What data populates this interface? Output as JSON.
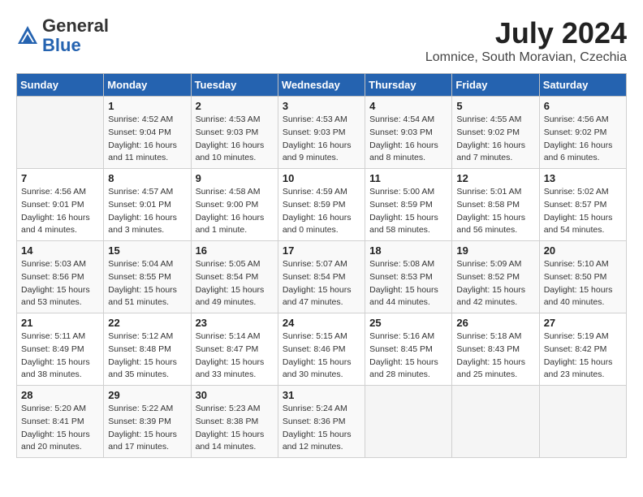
{
  "header": {
    "logo_general": "General",
    "logo_blue": "Blue",
    "month_title": "July 2024",
    "subtitle": "Lomnice, South Moravian, Czechia"
  },
  "days_of_week": [
    "Sunday",
    "Monday",
    "Tuesday",
    "Wednesday",
    "Thursday",
    "Friday",
    "Saturday"
  ],
  "weeks": [
    [
      {
        "day": "",
        "info": ""
      },
      {
        "day": "1",
        "info": "Sunrise: 4:52 AM\nSunset: 9:04 PM\nDaylight: 16 hours\nand 11 minutes."
      },
      {
        "day": "2",
        "info": "Sunrise: 4:53 AM\nSunset: 9:03 PM\nDaylight: 16 hours\nand 10 minutes."
      },
      {
        "day": "3",
        "info": "Sunrise: 4:53 AM\nSunset: 9:03 PM\nDaylight: 16 hours\nand 9 minutes."
      },
      {
        "day": "4",
        "info": "Sunrise: 4:54 AM\nSunset: 9:03 PM\nDaylight: 16 hours\nand 8 minutes."
      },
      {
        "day": "5",
        "info": "Sunrise: 4:55 AM\nSunset: 9:02 PM\nDaylight: 16 hours\nand 7 minutes."
      },
      {
        "day": "6",
        "info": "Sunrise: 4:56 AM\nSunset: 9:02 PM\nDaylight: 16 hours\nand 6 minutes."
      }
    ],
    [
      {
        "day": "7",
        "info": "Sunrise: 4:56 AM\nSunset: 9:01 PM\nDaylight: 16 hours\nand 4 minutes."
      },
      {
        "day": "8",
        "info": "Sunrise: 4:57 AM\nSunset: 9:01 PM\nDaylight: 16 hours\nand 3 minutes."
      },
      {
        "day": "9",
        "info": "Sunrise: 4:58 AM\nSunset: 9:00 PM\nDaylight: 16 hours\nand 1 minute."
      },
      {
        "day": "10",
        "info": "Sunrise: 4:59 AM\nSunset: 8:59 PM\nDaylight: 16 hours\nand 0 minutes."
      },
      {
        "day": "11",
        "info": "Sunrise: 5:00 AM\nSunset: 8:59 PM\nDaylight: 15 hours\nand 58 minutes."
      },
      {
        "day": "12",
        "info": "Sunrise: 5:01 AM\nSunset: 8:58 PM\nDaylight: 15 hours\nand 56 minutes."
      },
      {
        "day": "13",
        "info": "Sunrise: 5:02 AM\nSunset: 8:57 PM\nDaylight: 15 hours\nand 54 minutes."
      }
    ],
    [
      {
        "day": "14",
        "info": "Sunrise: 5:03 AM\nSunset: 8:56 PM\nDaylight: 15 hours\nand 53 minutes."
      },
      {
        "day": "15",
        "info": "Sunrise: 5:04 AM\nSunset: 8:55 PM\nDaylight: 15 hours\nand 51 minutes."
      },
      {
        "day": "16",
        "info": "Sunrise: 5:05 AM\nSunset: 8:54 PM\nDaylight: 15 hours\nand 49 minutes."
      },
      {
        "day": "17",
        "info": "Sunrise: 5:07 AM\nSunset: 8:54 PM\nDaylight: 15 hours\nand 47 minutes."
      },
      {
        "day": "18",
        "info": "Sunrise: 5:08 AM\nSunset: 8:53 PM\nDaylight: 15 hours\nand 44 minutes."
      },
      {
        "day": "19",
        "info": "Sunrise: 5:09 AM\nSunset: 8:52 PM\nDaylight: 15 hours\nand 42 minutes."
      },
      {
        "day": "20",
        "info": "Sunrise: 5:10 AM\nSunset: 8:50 PM\nDaylight: 15 hours\nand 40 minutes."
      }
    ],
    [
      {
        "day": "21",
        "info": "Sunrise: 5:11 AM\nSunset: 8:49 PM\nDaylight: 15 hours\nand 38 minutes."
      },
      {
        "day": "22",
        "info": "Sunrise: 5:12 AM\nSunset: 8:48 PM\nDaylight: 15 hours\nand 35 minutes."
      },
      {
        "day": "23",
        "info": "Sunrise: 5:14 AM\nSunset: 8:47 PM\nDaylight: 15 hours\nand 33 minutes."
      },
      {
        "day": "24",
        "info": "Sunrise: 5:15 AM\nSunset: 8:46 PM\nDaylight: 15 hours\nand 30 minutes."
      },
      {
        "day": "25",
        "info": "Sunrise: 5:16 AM\nSunset: 8:45 PM\nDaylight: 15 hours\nand 28 minutes."
      },
      {
        "day": "26",
        "info": "Sunrise: 5:18 AM\nSunset: 8:43 PM\nDaylight: 15 hours\nand 25 minutes."
      },
      {
        "day": "27",
        "info": "Sunrise: 5:19 AM\nSunset: 8:42 PM\nDaylight: 15 hours\nand 23 minutes."
      }
    ],
    [
      {
        "day": "28",
        "info": "Sunrise: 5:20 AM\nSunset: 8:41 PM\nDaylight: 15 hours\nand 20 minutes."
      },
      {
        "day": "29",
        "info": "Sunrise: 5:22 AM\nSunset: 8:39 PM\nDaylight: 15 hours\nand 17 minutes."
      },
      {
        "day": "30",
        "info": "Sunrise: 5:23 AM\nSunset: 8:38 PM\nDaylight: 15 hours\nand 14 minutes."
      },
      {
        "day": "31",
        "info": "Sunrise: 5:24 AM\nSunset: 8:36 PM\nDaylight: 15 hours\nand 12 minutes."
      },
      {
        "day": "",
        "info": ""
      },
      {
        "day": "",
        "info": ""
      },
      {
        "day": "",
        "info": ""
      }
    ]
  ]
}
